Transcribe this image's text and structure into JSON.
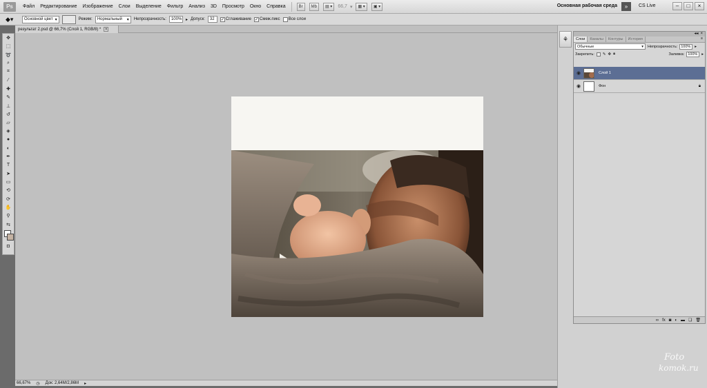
{
  "app": {
    "logo": "Ps"
  },
  "menu": [
    "Файл",
    "Редактирование",
    "Изображение",
    "Слои",
    "Выделение",
    "Фильтр",
    "Анализ",
    "3D",
    "Просмотр",
    "Окно",
    "Справка"
  ],
  "menubar": {
    "zoom": "66,7",
    "workspace": "Основная рабочая среда",
    "cslive": "CS Live"
  },
  "options": {
    "preset": "Основной цвет",
    "mode_label": "Режим:",
    "mode_value": "Нормальный",
    "opacity_label": "Непрозрачность:",
    "opacity_value": "100%",
    "tolerance_label": "Допуск:",
    "tolerance_value": "32",
    "antialias_label": "Сглаживание",
    "contiguous_label": "Смеж.пикс",
    "all_layers_label": "Все слои"
  },
  "document": {
    "tab_title": "результат 2.psd @ 66,7% (Слой 1, RGB/8) *"
  },
  "status": {
    "zoom": "66,67%",
    "doc_info": "Док: 2,64M/2,86M"
  },
  "layers_panel": {
    "tabs": [
      "Слои",
      "Каналы",
      "Контуры",
      "История"
    ],
    "blend_mode": "Обычные",
    "opacity_label": "Непрозрачность:",
    "opacity": "100%",
    "lock_label": "Закрепить:",
    "fill_label": "Заливка:",
    "fill": "100%",
    "layers": [
      {
        "name": "Слой 1",
        "selected": true
      },
      {
        "name": "Фон",
        "selected": false
      }
    ]
  },
  "watermark": {
    "line1": "Foto",
    "line2": "komok.ru"
  },
  "colors": {
    "accent": "#5c6e94",
    "canvas_bg": "#c0c0c0",
    "doc_bg": "#f7f6f2"
  }
}
